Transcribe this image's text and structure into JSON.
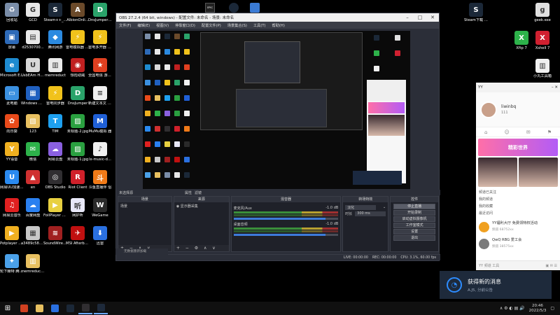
{
  "desktop_icons_left": [
    {
      "label": "回收站",
      "color": "#7a8da8",
      "glyph": "♻"
    },
    {
      "label": "GCD",
      "color": "#e7e7e7",
      "glyph": "G"
    },
    {
      "label": "Steam++_...",
      "color": "#1b2838",
      "glyph": "S"
    },
    {
      "label": "AlbionOnli...",
      "color": "#6b4a2a",
      "glyph": "A"
    },
    {
      "label": "DnsJumper(2)(7z",
      "color": "#2aa36a",
      "glyph": "D"
    },
    {
      "label": "屏幕",
      "color": "#2d6ab8",
      "glyph": "▣"
    },
    {
      "label": "d2530700...",
      "color": "#e8e8e8",
      "glyph": "▤"
    },
    {
      "label": "腾讯网游",
      "color": "#2b8ae0",
      "glyph": "◆"
    },
    {
      "label": "雷电模拟器 64",
      "color": "#f1c21b",
      "glyph": "⚡"
    },
    {
      "label": "雷电多开器 64",
      "color": "#f1c21b",
      "glyph": "⚡"
    },
    {
      "label": "Microsoft Edge",
      "color": "#1e8bd0",
      "glyph": "e"
    },
    {
      "label": "UsbEAm Hosts Editor",
      "color": "#d8d8d8",
      "glyph": "U"
    },
    {
      "label": "memreduct",
      "color": "#eaeaea",
      "glyph": "▥"
    },
    {
      "label": "惊险助威",
      "color": "#c02020",
      "glyph": "◉"
    },
    {
      "label": "全国电信 游戏新援 辅助",
      "color": "#e04020",
      "glyph": "★"
    },
    {
      "label": "此电脑",
      "color": "#3b90e0",
      "glyph": "▭"
    },
    {
      "label": "Windows 磁 声音缩混器",
      "color": "#2060c0",
      "glyph": "▦"
    },
    {
      "label": "雷电同步器",
      "color": "#f1c21b",
      "glyph": "⚡"
    },
    {
      "label": "DnsJumper",
      "color": "#2aa36a",
      "glyph": "D"
    },
    {
      "label": "新建文本文 档.txt",
      "color": "#f0f0f0",
      "glyph": "≡"
    },
    {
      "label": "向日葵",
      "color": "#e84a1a",
      "glyph": "✿"
    },
    {
      "label": "123",
      "color": "#e8c060",
      "glyph": "▧"
    },
    {
      "label": "TIM",
      "color": "#1ea0f0",
      "glyph": "T"
    },
    {
      "label": "未标题-2.jpg",
      "color": "#2aa040",
      "glyph": "▨"
    },
    {
      "label": "MuMu模拟 器",
      "color": "#1f5fd6",
      "glyph": "M"
    },
    {
      "label": "YY语音",
      "color": "#f0b020",
      "glyph": "Y"
    },
    {
      "label": "微信",
      "color": "#2db24a",
      "glyph": "✉"
    },
    {
      "label": "网易云盘",
      "color": "#8a60e0",
      "glyph": "☁"
    },
    {
      "label": "未标题-1.jpg",
      "color": "#2aa040",
      "glyph": "▨"
    },
    {
      "label": "lx-music-d...",
      "color": "#f0f0f0",
      "glyph": "♪"
    },
    {
      "label": "网易UU加速 器",
      "color": "#2a8af0",
      "glyph": "U"
    },
    {
      "label": "en",
      "color": "#d03030",
      "glyph": "▲"
    },
    {
      "label": "OBS Studio",
      "color": "#302e31",
      "glyph": "◎"
    },
    {
      "label": "Riot Client",
      "color": "#d0202a",
      "glyph": "R"
    },
    {
      "label": "斗鱼直播伴 侣",
      "color": "#f07a18",
      "glyph": "斗"
    },
    {
      "label": "网易云音乐",
      "color": "#e02020",
      "glyph": "♫"
    },
    {
      "label": "百度网盘",
      "color": "#2a80f0",
      "glyph": "☁"
    },
    {
      "label": "FoilPlayer 64 bit",
      "color": "#e8d040",
      "glyph": "▶"
    },
    {
      "label": "网护听",
      "color": "#e8e8f8",
      "glyph": "听"
    },
    {
      "label": "WeGame",
      "color": "#2a2a2a",
      "glyph": "W"
    },
    {
      "label": "Potplayer 视频播放",
      "color": "#f0b020",
      "glyph": "▶"
    },
    {
      "label": "a3489c58d...",
      "color": "#c8c8c8",
      "glyph": "▦"
    },
    {
      "label": "SoundWire Server",
      "color": "#a02020",
      "glyph": "≋"
    },
    {
      "label": "MSI Afterburner",
      "color": "#c01010",
      "glyph": "✈"
    },
    {
      "label": "迅雷",
      "color": "#2a70e0",
      "glyph": "⬇"
    },
    {
      "label": "轮下赫特 腾讯游戏",
      "color": "#4aa0e8",
      "glyph": "✦"
    },
    {
      "label": "memreduct (2)",
      "color": "#e8c060",
      "glyph": "▥"
    }
  ],
  "desktop_icons_right": [
    {
      "label": "Steam下载 CDN重定向",
      "color": "#1b2838",
      "glyph": "S"
    },
    {
      "label": "geek.exe",
      "color": "#e0e0e0",
      "glyph": "g"
    },
    {
      "label": "Xftp 7",
      "color": "#2db24a",
      "glyph": "X"
    },
    {
      "label": "Xshell 7",
      "color": "#d02030",
      "glyph": "X"
    },
    {
      "label": "小丸工具箱",
      "color": "#f0f0f0",
      "glyph": "▥"
    }
  ],
  "top_bar_icons": [
    {
      "label": "EPIC GAMES",
      "color": "#222"
    },
    {
      "label": "Steam",
      "color": "#1b2838"
    },
    {
      "label": "Chrome",
      "color": "#3a7bd5"
    }
  ],
  "obs": {
    "title": "OBS 27.2.4 (64 bit, windows) - 配置文件: 未命名 - 场景: 未命名",
    "menu": [
      "文件(F)",
      "编辑(E)",
      "视图(V)",
      "停靠窗口(D)",
      "配置文件(P)",
      "场景集合(S)",
      "工具(T)",
      "帮助(H)"
    ],
    "scene_bar_label": "未选择源",
    "scene_bar_props": "属性",
    "scene_bar_filters": "滤镜",
    "dock_scenes": "场景",
    "dock_sources": "来源",
    "dock_mixer": "混音器",
    "dock_transitions": "转场特效",
    "dock_controls": "控件",
    "scene_item": "场景",
    "source_item": "显示器采集",
    "mixer_track1_name": "桌面音频",
    "mixer_track1_db": "-1.0 dB",
    "mixer_track2_name": "麦克风/Aux",
    "mixer_track2_db": "-1.0 dB",
    "transition_label": "淡化",
    "duration_label": "时长",
    "duration_value": "300 ms",
    "controls": [
      "停止直播",
      "开始录制",
      "启动虚拟摄像机",
      "工作室模式",
      "设置",
      "退出"
    ],
    "status_live": "LIVE: 00:00:00",
    "status_rec": "REC: 00:00:00",
    "status_cpu": "CPU: 3.1%, 60.00 fps",
    "below_text": "无数据重新加载"
  },
  "yy": {
    "top_label": "YY",
    "name": "liwinbq",
    "sub": "111",
    "banner": "精彩世界",
    "list_header": "频道已关注",
    "list_rows": [
      "我的频道",
      "我的收藏",
      "最近访问"
    ],
    "items": [
      {
        "name": "YY福利大厅 免费领特权活动",
        "desc": "频道 68752xx",
        "color": "#f0a020"
      },
      {
        "name": "QwQ RBG 爱工会",
        "desc": "频道 38575xx",
        "color": "#7a7a7a"
      }
    ],
    "bottom_left": "YY 频道 工具"
  },
  "notification": {
    "title": "获得新的消息",
    "sub": "A.J5,  分前公告"
  },
  "taskbar": {
    "start_glyph": "⊞",
    "apps": [
      {
        "color": "#d04020"
      },
      {
        "color": "#e8c060"
      },
      {
        "color": "#2a70e0"
      },
      {
        "color": "#1b2838"
      },
      {
        "color": "#302e31"
      },
      {
        "color": "#1e2a3b"
      }
    ],
    "time": "20:46",
    "date": "2022/5/3"
  }
}
